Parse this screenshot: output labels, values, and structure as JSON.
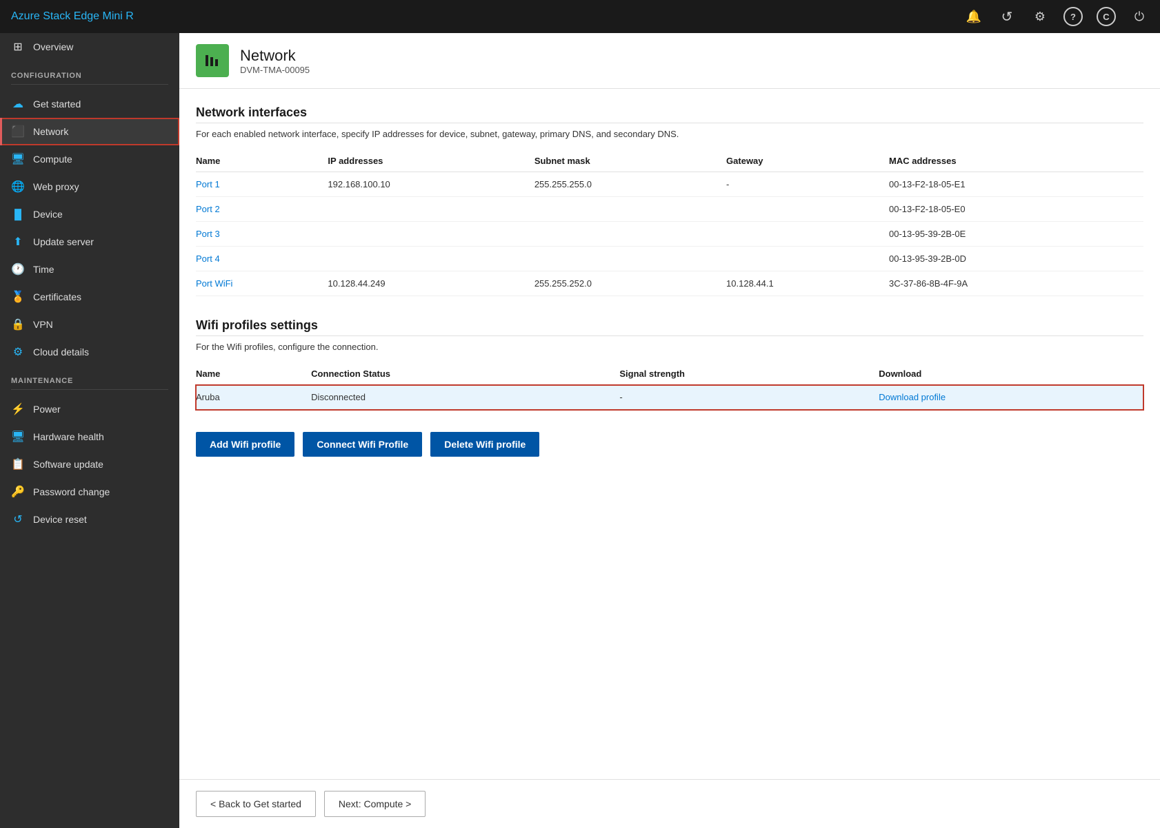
{
  "app": {
    "title": "Azure Stack Edge Mini R"
  },
  "topbar_icons": [
    {
      "name": "bell-icon",
      "symbol": "🔔"
    },
    {
      "name": "refresh-icon",
      "symbol": "↺"
    },
    {
      "name": "settings-icon",
      "symbol": "⚙"
    },
    {
      "name": "help-icon",
      "symbol": "?"
    },
    {
      "name": "copyright-icon",
      "symbol": "C"
    },
    {
      "name": "power-icon",
      "symbol": "⏻"
    }
  ],
  "sidebar": {
    "configuration_label": "CONFIGURATION",
    "maintenance_label": "MAINTENANCE",
    "config_items": [
      {
        "id": "overview",
        "label": "Overview",
        "icon": "⊞"
      },
      {
        "id": "get-started",
        "label": "Get started",
        "icon": "☁"
      },
      {
        "id": "network",
        "label": "Network",
        "icon": "⊟",
        "active": true
      },
      {
        "id": "compute",
        "label": "Compute",
        "icon": "🖥"
      },
      {
        "id": "web-proxy",
        "label": "Web proxy",
        "icon": "🌐"
      },
      {
        "id": "device",
        "label": "Device",
        "icon": "▐▌"
      },
      {
        "id": "update-server",
        "label": "Update server",
        "icon": "⬆"
      },
      {
        "id": "time",
        "label": "Time",
        "icon": "⏱"
      },
      {
        "id": "certificates",
        "label": "Certificates",
        "icon": "🏅"
      },
      {
        "id": "vpn",
        "label": "VPN",
        "icon": "🔒"
      },
      {
        "id": "cloud-details",
        "label": "Cloud details",
        "icon": "⚙"
      }
    ],
    "maintenance_items": [
      {
        "id": "power",
        "label": "Power",
        "icon": "⚡"
      },
      {
        "id": "hardware-health",
        "label": "Hardware health",
        "icon": "🖥"
      },
      {
        "id": "software-update",
        "label": "Software update",
        "icon": "📋"
      },
      {
        "id": "password-change",
        "label": "Password change",
        "icon": "🔑"
      },
      {
        "id": "device-reset",
        "label": "Device reset",
        "icon": "↺"
      }
    ]
  },
  "page": {
    "title": "Network",
    "subtitle": "DVM-TMA-00095"
  },
  "network_interfaces": {
    "section_title": "Network interfaces",
    "description": "For each enabled network interface, specify IP addresses for device, subnet, gateway, primary DNS, and secondary DNS.",
    "columns": [
      "Name",
      "IP addresses",
      "Subnet mask",
      "Gateway",
      "MAC addresses"
    ],
    "rows": [
      {
        "name": "Port 1",
        "ip": "192.168.100.10",
        "subnet": "255.255.255.0",
        "gateway": "-",
        "mac": "00-13-F2-18-05-E1"
      },
      {
        "name": "Port 2",
        "ip": "",
        "subnet": "",
        "gateway": "",
        "mac": "00-13-F2-18-05-E0"
      },
      {
        "name": "Port 3",
        "ip": "",
        "subnet": "",
        "gateway": "",
        "mac": "00-13-95-39-2B-0E"
      },
      {
        "name": "Port 4",
        "ip": "",
        "subnet": "",
        "gateway": "",
        "mac": "00-13-95-39-2B-0D"
      },
      {
        "name": "Port WiFi",
        "ip": "10.128.44.249",
        "subnet": "255.255.252.0",
        "gateway": "10.128.44.1",
        "mac": "3C-37-86-8B-4F-9A"
      }
    ]
  },
  "wifi_profiles": {
    "section_title": "Wifi profiles settings",
    "description": "For the Wifi profiles, configure the connection.",
    "columns": [
      "Name",
      "Connection Status",
      "Signal strength",
      "Download"
    ],
    "rows": [
      {
        "name": "Aruba",
        "status": "Disconnected",
        "signal": "-",
        "download_label": "Download profile",
        "selected": true
      }
    ],
    "buttons": [
      {
        "id": "add-wifi",
        "label": "Add Wifi profile"
      },
      {
        "id": "connect-wifi",
        "label": "Connect Wifi Profile"
      },
      {
        "id": "delete-wifi",
        "label": "Delete Wifi profile"
      }
    ]
  },
  "footer": {
    "back_label": "< Back to Get started",
    "next_label": "Next: Compute >"
  }
}
